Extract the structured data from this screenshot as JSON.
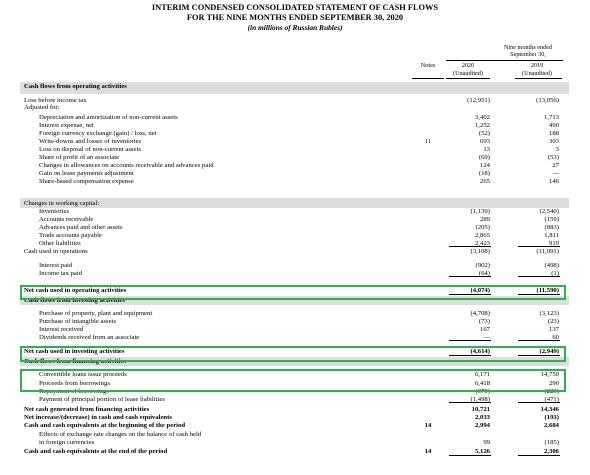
{
  "header": {
    "title": "INTERIM CONDENSED CONSOLIDATED STATEMENT OF CASH FLOWS",
    "subtitle": "FOR THE NINE MONTHS ENDED SEPTEMBER 30, 2020",
    "units": "(in millions of Russian Rubles)"
  },
  "columns": {
    "notes": "Notes",
    "period_line1": "Nine months ended",
    "period_line2": "September 30,",
    "y2020": "2020",
    "y2019": "2019",
    "unaudited_2020": "(Unaudited)",
    "unaudited_2019": "(Unaudited)"
  },
  "rows": [
    {
      "label": "Cash flows from operating activities",
      "style": "section",
      "note": "",
      "v2020": "",
      "v2019": ""
    },
    {
      "label": "Loss before income tax",
      "style": "plain",
      "note": "",
      "v2020": "(12,951)",
      "v2019": "(13,056)"
    },
    {
      "label": "Adjusted for:",
      "style": "plain",
      "note": "",
      "v2020": "",
      "v2019": ""
    },
    {
      "label": "Depreciation and amortization of non-current assets",
      "style": "indent",
      "note": "",
      "v2020": "3,402",
      "v2019": "1,713"
    },
    {
      "label": "Interest expense, net",
      "style": "indent",
      "note": "",
      "v2020": "1,252",
      "v2019": "490"
    },
    {
      "label": "Foreign currency exchange (gain) / loss, net",
      "style": "indent",
      "note": "",
      "v2020": "(52)",
      "v2019": "188"
    },
    {
      "label": "Write-downs and losses of inventories",
      "style": "indent",
      "note": "11",
      "v2020": "693",
      "v2019": "303"
    },
    {
      "label": "Loss on disposal of non-current assets",
      "style": "indent",
      "note": "",
      "v2020": "13",
      "v2019": "3"
    },
    {
      "label": "Share of profit of an associate",
      "style": "indent",
      "note": "",
      "v2020": "(69)",
      "v2019": "(53)"
    },
    {
      "label": "Changes in allowances on accounts receivable and advances paid",
      "style": "indent",
      "note": "",
      "v2020": "124",
      "v2019": "27"
    },
    {
      "label": "Gain on lease payments adjustment",
      "style": "indent",
      "note": "",
      "v2020": "(18)",
      "v2019": "—"
    },
    {
      "label": "Share-based compensation expense",
      "style": "indent",
      "note": "",
      "v2020": "265",
      "v2019": "146"
    },
    {
      "label": "Changes in working capital:",
      "style": "plain",
      "note": "",
      "v2020": "",
      "v2019": ""
    },
    {
      "label": "Inventories",
      "style": "indent",
      "note": "",
      "v2020": "(1,139)",
      "v2019": "(2,540)"
    },
    {
      "label": "Accounts receivable",
      "style": "indent",
      "note": "",
      "v2020": "289",
      "v2019": "(159)"
    },
    {
      "label": "Advances paid and other assets",
      "style": "indent",
      "note": "",
      "v2020": "(205)",
      "v2019": "(883)"
    },
    {
      "label": "Trade accounts payable",
      "style": "indent",
      "note": "",
      "v2020": "2,865",
      "v2019": "1,811"
    },
    {
      "label": "Other liabilities",
      "style": "indent",
      "note": "",
      "v2020": "2,423",
      "v2019": "919"
    },
    {
      "label": "Cash used in operations",
      "style": "plain",
      "note": "",
      "v2020": "(3,108)",
      "v2019": "(11,091)"
    },
    {
      "label": "Interest paid",
      "style": "indent",
      "note": "",
      "v2020": "(902)",
      "v2019": "(498)"
    },
    {
      "label": "Income tax paid",
      "style": "indent",
      "note": "",
      "v2020": "(64)",
      "v2019": "(1)"
    },
    {
      "label": "Net cash used in operating activities",
      "style": "bold",
      "note": "",
      "v2020": "(4,074)",
      "v2019": "(11,590)"
    },
    {
      "label": "Cash flows from investing activities",
      "style": "section",
      "note": "",
      "v2020": "",
      "v2019": ""
    },
    {
      "label": "Purchase of property, plant and equipment",
      "style": "indent",
      "note": "",
      "v2020": "(4,708)",
      "v2019": "(3,123)"
    },
    {
      "label": "Purchase of intangible assets",
      "style": "indent",
      "note": "",
      "v2020": "(73)",
      "v2019": "(23)"
    },
    {
      "label": "Interest received",
      "style": "indent",
      "note": "",
      "v2020": "167",
      "v2019": "137"
    },
    {
      "label": "Dividends received from an associate",
      "style": "indent",
      "note": "",
      "v2020": "—",
      "v2019": "60"
    },
    {
      "label": "Net cash used in investing activities",
      "style": "bold",
      "note": "",
      "v2020": "(4,614)",
      "v2019": "(2,949)"
    },
    {
      "label": "Cash flows from financing activities",
      "style": "section",
      "note": "",
      "v2020": "",
      "v2019": ""
    },
    {
      "label": "Convertible loans issue proceeds",
      "style": "indent",
      "note": "",
      "v2020": "6,171",
      "v2019": "14,750"
    },
    {
      "label": "Proceeds from borrowings",
      "style": "indent",
      "note": "",
      "v2020": "6,418",
      "v2019": "290"
    },
    {
      "label": "Repayment of borrowings",
      "style": "indent",
      "note": "",
      "v2020": "(370)",
      "v2019": "(223)"
    },
    {
      "label": "Payment of principal portion of lease liabilities",
      "style": "indent",
      "note": "",
      "v2020": "(1,498)",
      "v2019": "(471)"
    },
    {
      "label": "Net cash generated from financing activities",
      "style": "bold",
      "note": "",
      "v2020": "10,721",
      "v2019": "14,346"
    },
    {
      "label": "Net increase/(decrease) in cash and cash equivalents",
      "style": "bold",
      "note": "",
      "v2020": "2,033",
      "v2019": "(193)"
    },
    {
      "label": "Cash and cash equivalents at the beginning of the period",
      "style": "bold",
      "note": "14",
      "v2020": "2,994",
      "v2019": "2,684"
    },
    {
      "label": "Effects of exchange rate changes on the balance of cash held",
      "style": "indent",
      "note": "",
      "v2020": "",
      "v2019": ""
    },
    {
      "label": "in foreign currencies",
      "style": "indent",
      "note": "",
      "v2020": "99",
      "v2019": "(185)"
    },
    {
      "label": "Cash and cash equivalents at the end of the period",
      "style": "bold",
      "note": "14",
      "v2020": "5,126",
      "v2019": "2,306"
    }
  ],
  "colors": {
    "highlight": "#2fb24a",
    "section_shade": "#dcdcdc"
  }
}
